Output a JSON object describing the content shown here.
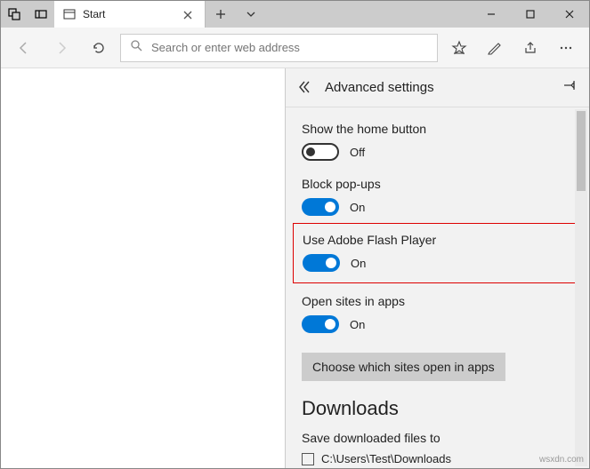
{
  "titlebar": {
    "tab_title": "Start"
  },
  "toolbar": {
    "search_placeholder": "Search or enter web address"
  },
  "panel": {
    "title": "Advanced settings",
    "settings": {
      "home_button": {
        "label": "Show the home button",
        "state": "Off"
      },
      "block_popups": {
        "label": "Block pop-ups",
        "state": "On"
      },
      "flash": {
        "label": "Use Adobe Flash Player",
        "state": "On"
      },
      "open_apps": {
        "label": "Open sites in apps",
        "state": "On"
      }
    },
    "choose_sites_label": "Choose which sites open in apps",
    "downloads_heading": "Downloads",
    "downloads_label": "Save downloaded files to",
    "downloads_path": "C:\\Users\\Test\\Downloads"
  },
  "watermark": "wsxdn.com"
}
